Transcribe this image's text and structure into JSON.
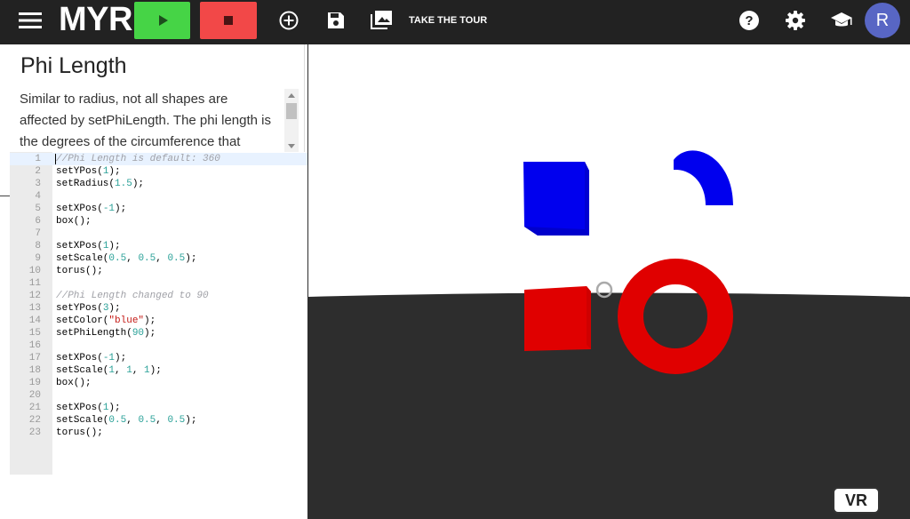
{
  "app": {
    "logo": "MYR"
  },
  "toolbar": {
    "tour_label": "TAKE THE TOUR",
    "avatar_initial": "R",
    "run_color": "#46d446",
    "stop_color": "#f24848"
  },
  "reference": {
    "title": "Phi Length",
    "body": "Similar to radius, not all shapes are affected by setPhiLength. The phi length is the degrees of the circumference that",
    "progress": 0.29
  },
  "editor": {
    "lines": [
      {
        "n": "1",
        "t": "//Phi Length is default: 360"
      },
      {
        "n": "2",
        "t": "setYPos(1);"
      },
      {
        "n": "3",
        "t": "setRadius(1.5);"
      },
      {
        "n": "4",
        "t": ""
      },
      {
        "n": "5",
        "t": "setXPos(-1);"
      },
      {
        "n": "6",
        "t": "box();"
      },
      {
        "n": "7",
        "t": ""
      },
      {
        "n": "8",
        "t": "setXPos(1);"
      },
      {
        "n": "9",
        "t": "setScale(0.5, 0.5, 0.5);"
      },
      {
        "n": "10",
        "t": "torus();"
      },
      {
        "n": "11",
        "t": ""
      },
      {
        "n": "12",
        "t": "//Phi Length changed to 90"
      },
      {
        "n": "13",
        "t": "setYPos(3);"
      },
      {
        "n": "14",
        "t": "setColor(\"blue\");"
      },
      {
        "n": "15",
        "t": "setPhiLength(90);"
      },
      {
        "n": "16",
        "t": ""
      },
      {
        "n": "17",
        "t": "setXPos(-1);"
      },
      {
        "n": "18",
        "t": "setScale(1, 1, 1);"
      },
      {
        "n": "19",
        "t": "box();"
      },
      {
        "n": "20",
        "t": ""
      },
      {
        "n": "21",
        "t": "setXPos(1);"
      },
      {
        "n": "22",
        "t": "setScale(0.5, 0.5, 0.5);"
      },
      {
        "n": "23",
        "t": "torus();"
      }
    ]
  },
  "scene": {
    "vr_label": "VR",
    "sky_color": "#ffffff",
    "ground_color": "#2d2d2d",
    "shape_colors": {
      "blue": "#0000ee",
      "red": "#e00000"
    }
  }
}
